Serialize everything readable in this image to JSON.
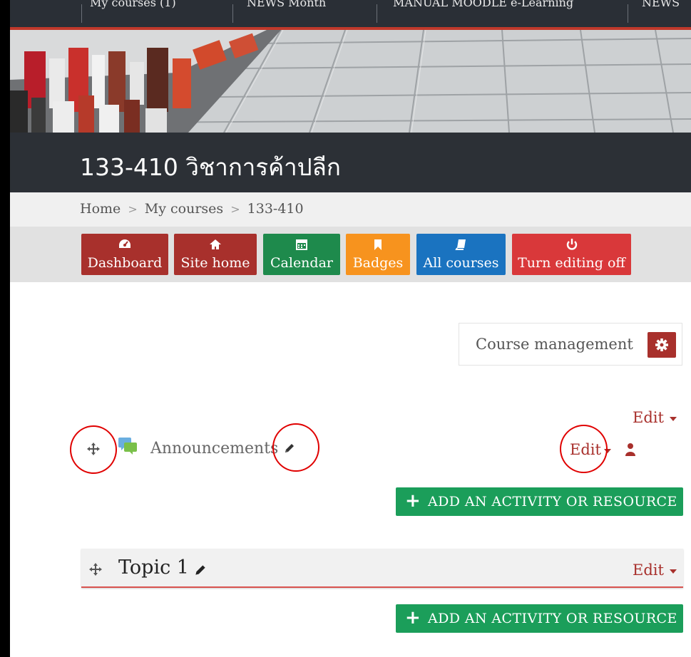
{
  "topnav": {
    "items": [
      "My courses (1)",
      "NEWS Month",
      "MANUAL MOODLE e-Learning",
      "NEWS"
    ]
  },
  "course": {
    "title": "133-410 วิชาการค้าปลีก"
  },
  "breadcrumb": {
    "items": [
      "Home",
      "My courses",
      "133-410"
    ],
    "separator": ">"
  },
  "quick_buttons": [
    {
      "label": "Dashboard",
      "icon": "dashboard-icon",
      "color": "#a8302c"
    },
    {
      "label": "Site home",
      "icon": "home-icon",
      "color": "#a8302c"
    },
    {
      "label": "Calendar",
      "icon": "calendar-icon",
      "color": "#1e8a4c"
    },
    {
      "label": "Badges",
      "icon": "bookmark-icon",
      "color": "#f7931e"
    },
    {
      "label": "All courses",
      "icon": "book-icon",
      "color": "#1a73c0"
    },
    {
      "label": "Turn editing off",
      "icon": "power-icon",
      "color": "#d9383a"
    }
  ],
  "course_management": {
    "label": "Course management",
    "icon": "gear-icon"
  },
  "section0": {
    "edit_label": "Edit",
    "activity": {
      "name": "Announcements",
      "icon": "forum-icon",
      "edit_label": "Edit"
    },
    "add_label": "ADD AN ACTIVITY OR RESOURCE"
  },
  "topic1": {
    "title": "Topic 1",
    "edit_label": "Edit",
    "add_label": "ADD AN ACTIVITY OR RESOURCE"
  },
  "colors": {
    "brand_red": "#a8302c",
    "add_green": "#1b9e5a",
    "annotation_red": "#e00000"
  }
}
